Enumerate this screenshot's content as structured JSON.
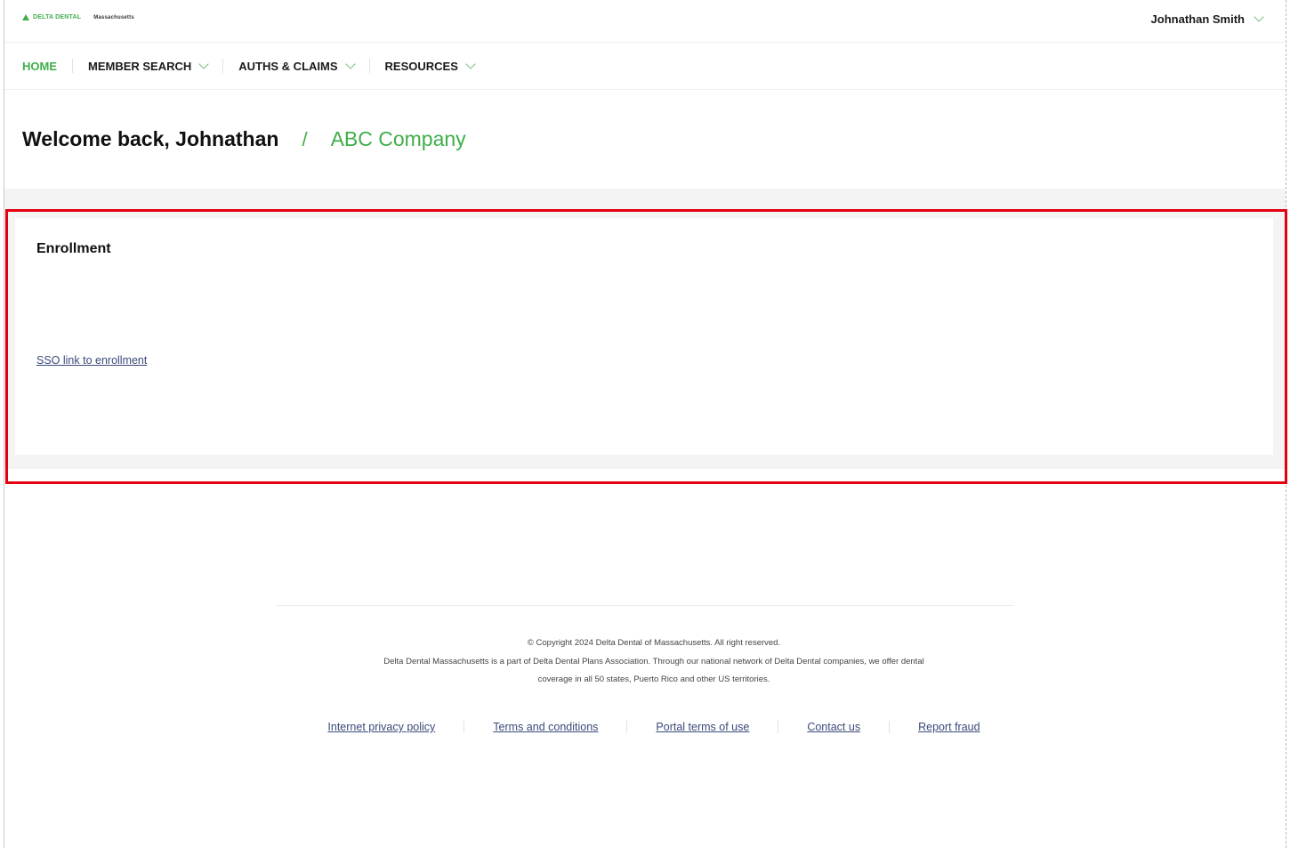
{
  "header": {
    "brand": "DELTA DENTAL",
    "region": "Massachusetts",
    "user_name": "Johnathan Smith"
  },
  "nav": {
    "items": [
      {
        "label": "HOME",
        "active": true
      },
      {
        "label": "MEMBER SEARCH",
        "has_dropdown": true
      },
      {
        "label": "AUTHS & CLAIMS",
        "has_dropdown": true
      },
      {
        "label": "RESOURCES",
        "has_dropdown": true
      }
    ]
  },
  "welcome": {
    "greeting": "Welcome back, Johnathan",
    "separator": "/",
    "company": "ABC Company"
  },
  "enrollment": {
    "title": "Enrollment",
    "link_label": "SSO link to enrollment"
  },
  "footer": {
    "copyright": "© Copyright 2024 Delta Dental of Massachusetts. All right reserved.",
    "description_line1": "Delta Dental Massachusetts is a part of Delta Dental Plans Association. Through our national network of Delta Dental companies, we offer dental",
    "description_line2": "coverage in all 50 states, Puerto Rico and other US territories.",
    "links": [
      "Internet privacy policy",
      "Terms and conditions",
      "Portal terms of use",
      "Contact us",
      "Report fraud"
    ]
  },
  "colors": {
    "brand_green": "#3fae49",
    "link_blue": "#3b4a7a",
    "highlight_red": "#e4000f"
  }
}
